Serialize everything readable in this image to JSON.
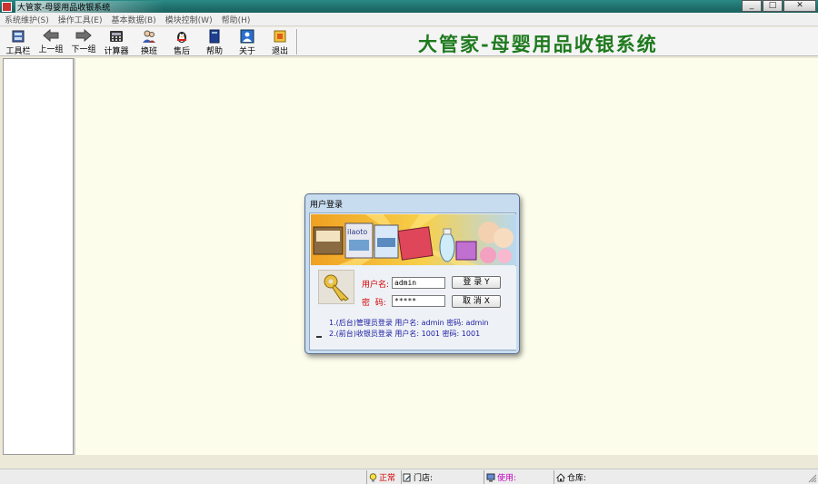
{
  "window": {
    "title": "大管家-母婴用品收银系统",
    "controls": {
      "minimize": "_",
      "maximize": "□",
      "close": "✕"
    }
  },
  "menu": [
    "系统维护(S)",
    "操作工具(E)",
    "基本数据(B)",
    "模块控制(W)",
    "帮助(H)"
  ],
  "toolbar": {
    "buttons": [
      {
        "label": "工具栏",
        "icon": "toolbar-icon"
      },
      {
        "label": "上一组",
        "icon": "arrow-left-icon"
      },
      {
        "label": "下一组",
        "icon": "arrow-right-icon"
      },
      {
        "label": "计算器",
        "icon": "calculator-icon"
      },
      {
        "label": "换班",
        "icon": "users-icon"
      },
      {
        "label": "售后",
        "icon": "qq-penguin-icon"
      },
      {
        "label": "帮助",
        "icon": "help-book-icon"
      },
      {
        "label": "关于",
        "icon": "about-user-icon"
      },
      {
        "label": "退出",
        "icon": "exit-icon"
      }
    ],
    "banner": "大管家-母婴用品收银系统"
  },
  "dialog": {
    "title": "用户登录",
    "promo_text": "ilaoto",
    "username_label": "用户名:",
    "password_label": "密  码:",
    "username_value": "admin",
    "password_value": "*****",
    "login_button": "登 录 Y",
    "cancel_button": "取 消 X",
    "hints": [
      "1.(后台)管理员登录  用户名: admin    密码: admin",
      "2.(前台)收银员登录  用户名: 1001     密码: 1001"
    ]
  },
  "statusbar": {
    "status": "正常",
    "store_label": "门店:",
    "user_label": "使用:",
    "warehouse_label": "仓库:"
  },
  "colors": {
    "titlebar": "#1f6f6c",
    "banner_text": "#1e7a1e",
    "content_bg": "#fdfdec",
    "label_red": "#d40000",
    "hint_blue": "#1a1aa0",
    "user_magenta": "#c000c0"
  }
}
